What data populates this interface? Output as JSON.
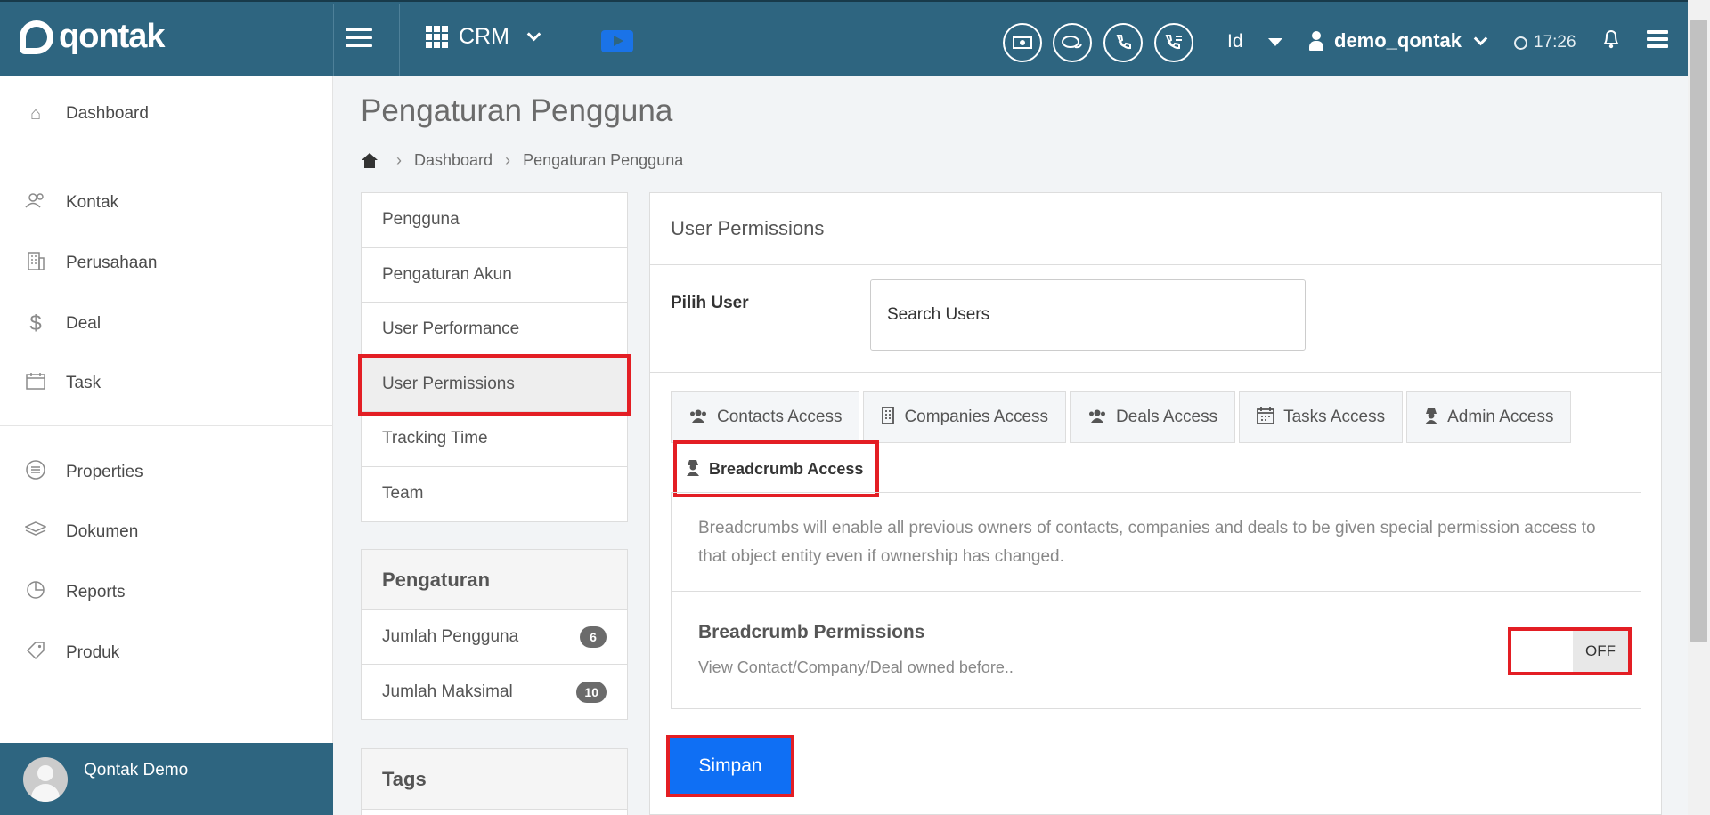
{
  "topbar": {
    "logo_text": "qontak",
    "app_name": "CRM",
    "language": "Id",
    "username": "demo_qontak",
    "time": "17:26",
    "circle_buttons": [
      "payment-icon",
      "chat-icon",
      "phone-icon",
      "call-log-icon"
    ]
  },
  "sidebar": {
    "items": [
      {
        "label": "Dashboard",
        "icon": "home-icon"
      },
      {
        "label": "Kontak",
        "icon": "contacts-icon"
      },
      {
        "label": "Perusahaan",
        "icon": "building-icon"
      },
      {
        "label": "Deal",
        "icon": "dollar-icon"
      },
      {
        "label": "Task",
        "icon": "calendar-icon"
      },
      {
        "label": "Properties",
        "icon": "list-icon"
      },
      {
        "label": "Dokumen",
        "icon": "layers-icon"
      },
      {
        "label": "Reports",
        "icon": "pie-chart-icon"
      },
      {
        "label": "Produk",
        "icon": "tag-icon"
      }
    ],
    "footer_name": "Qontak Demo"
  },
  "page": {
    "title": "Pengaturan Pengguna",
    "breadcrumb": [
      "Dashboard",
      "Pengaturan Pengguna"
    ]
  },
  "settings_nav": {
    "items": [
      "Pengguna",
      "Pengaturan Akun",
      "User Performance",
      "User Permissions",
      "Tracking Time",
      "Team"
    ],
    "active": "User Permissions"
  },
  "pengaturan_panel": {
    "title": "Pengaturan",
    "rows": [
      {
        "label": "Jumlah Pengguna",
        "count": "6"
      },
      {
        "label": "Jumlah Maksimal",
        "count": "10"
      }
    ]
  },
  "tags_panel": {
    "title": "Tags"
  },
  "permissions": {
    "header": "User Permissions",
    "pick_user_label": "Pilih User",
    "search_placeholder": "Search Users",
    "tabs": [
      {
        "label": "Contacts Access",
        "icon": "users-icon"
      },
      {
        "label": "Companies Access",
        "icon": "building-icon"
      },
      {
        "label": "Deals Access",
        "icon": "users-icon"
      },
      {
        "label": "Tasks Access",
        "icon": "calendar-icon"
      },
      {
        "label": "Admin Access",
        "icon": "spy-icon"
      }
    ],
    "active_tab": "Breadcrumb Access",
    "description": "Breadcrumbs will enable all previous owners of contacts, companies and deals to be given special permission access to that object entity even if ownership has changed.",
    "perm_title": "Breadcrumb Permissions",
    "perm_subtitle": "View Contact/Company/Deal owned before..",
    "toggle_state": "OFF",
    "save_label": "Simpan"
  },
  "colors": {
    "topbar": "#2e6580",
    "highlight": "#e31e24",
    "primary_button": "#0f6ff4"
  }
}
